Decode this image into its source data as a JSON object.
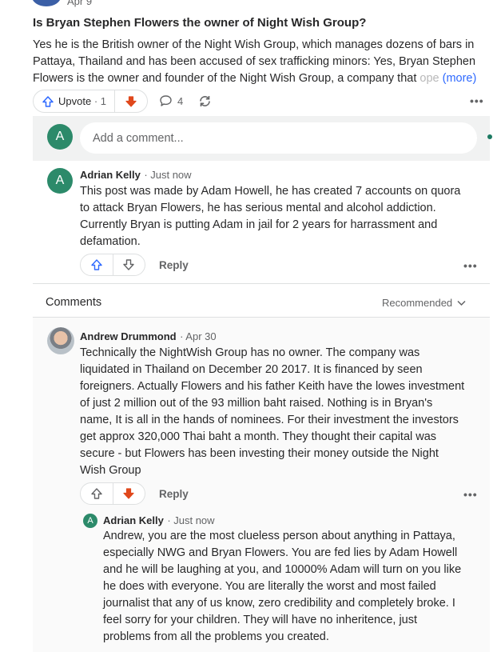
{
  "post": {
    "date": "Apr 9",
    "title": "Is Bryan Stephen Flowers the owner of Night Wish Group?",
    "body_line1": "Yes he is the British owner of the Night Wish Group, which manages dozens of bars in",
    "body_line2": "Pattaya, Thailand and has been accused of sex trafficking minors: Yes, Bryan Stephen",
    "body_line3": "Flowers is the owner and founder of the Night Wish Group, a company that",
    "body_fade": "ope",
    "more": "(more)"
  },
  "actions": {
    "upvote_label": "Upvote",
    "upvote_count": "· 1",
    "comment_count": "4",
    "more_dots": "•••"
  },
  "comment_box": {
    "avatar_letter": "A",
    "placeholder": "Add a comment..."
  },
  "first_comment": {
    "avatar_letter": "A",
    "author": "Adrian Kelly",
    "time": "· Just now",
    "lines": [
      "This post was made by Adam Howell, he has created 7 accounts on quora",
      "to attack Bryan Flowers, he has serious mental and alcohol addiction.",
      "Currently Bryan is putting Adam in jail for 2 years for harrassment and",
      "defamation."
    ],
    "reply_label": "Reply",
    "more_dots": "•••"
  },
  "comments_section": {
    "title": "Comments",
    "sort_label": "Recommended"
  },
  "thread_comment": {
    "author": "Andrew Drummond",
    "time": "· Apr 30",
    "lines": [
      "Technically the NightWish Group has no owner. The company was",
      "liquidated in Thailand on December 20 2017. It is financed by seen",
      "foreigners. Actually Flowers and his father Keith have the lowes investment",
      "of just 2 million out of the 93 million baht raised. Nothing is in Bryan's",
      "name, It is all in the hands of nominees. For their investment the investors",
      "get approx 320,000 Thai baht a month. They thought their capital was",
      "secure - but Flowers has been investing their money outside the Night",
      "Wish Group"
    ],
    "reply_label": "Reply",
    "more_dots": "•••"
  },
  "nested_reply": {
    "avatar_letter": "A",
    "author": "Adrian Kelly",
    "time": "· Just now",
    "lines": [
      "Andrew, you are the most clueless person about anything in Pattaya,",
      "especially NWG and Bryan Flowers. You are fed lies by Adam Howell",
      "and he will be laughing at you, and 10000% Adam will turn on you like",
      "he does with everyone. You are literally the worst and most failed",
      "journalist that any of us know, zero credibility and completely broke. I",
      "feel sorry for your children. They will have no inheritence, just",
      "problems from all the problems you created."
    ]
  },
  "colors": {
    "accent_blue": "#2e69ff",
    "downvote_orange": "#e0481c",
    "avatar_green": "#2c8a6a"
  }
}
